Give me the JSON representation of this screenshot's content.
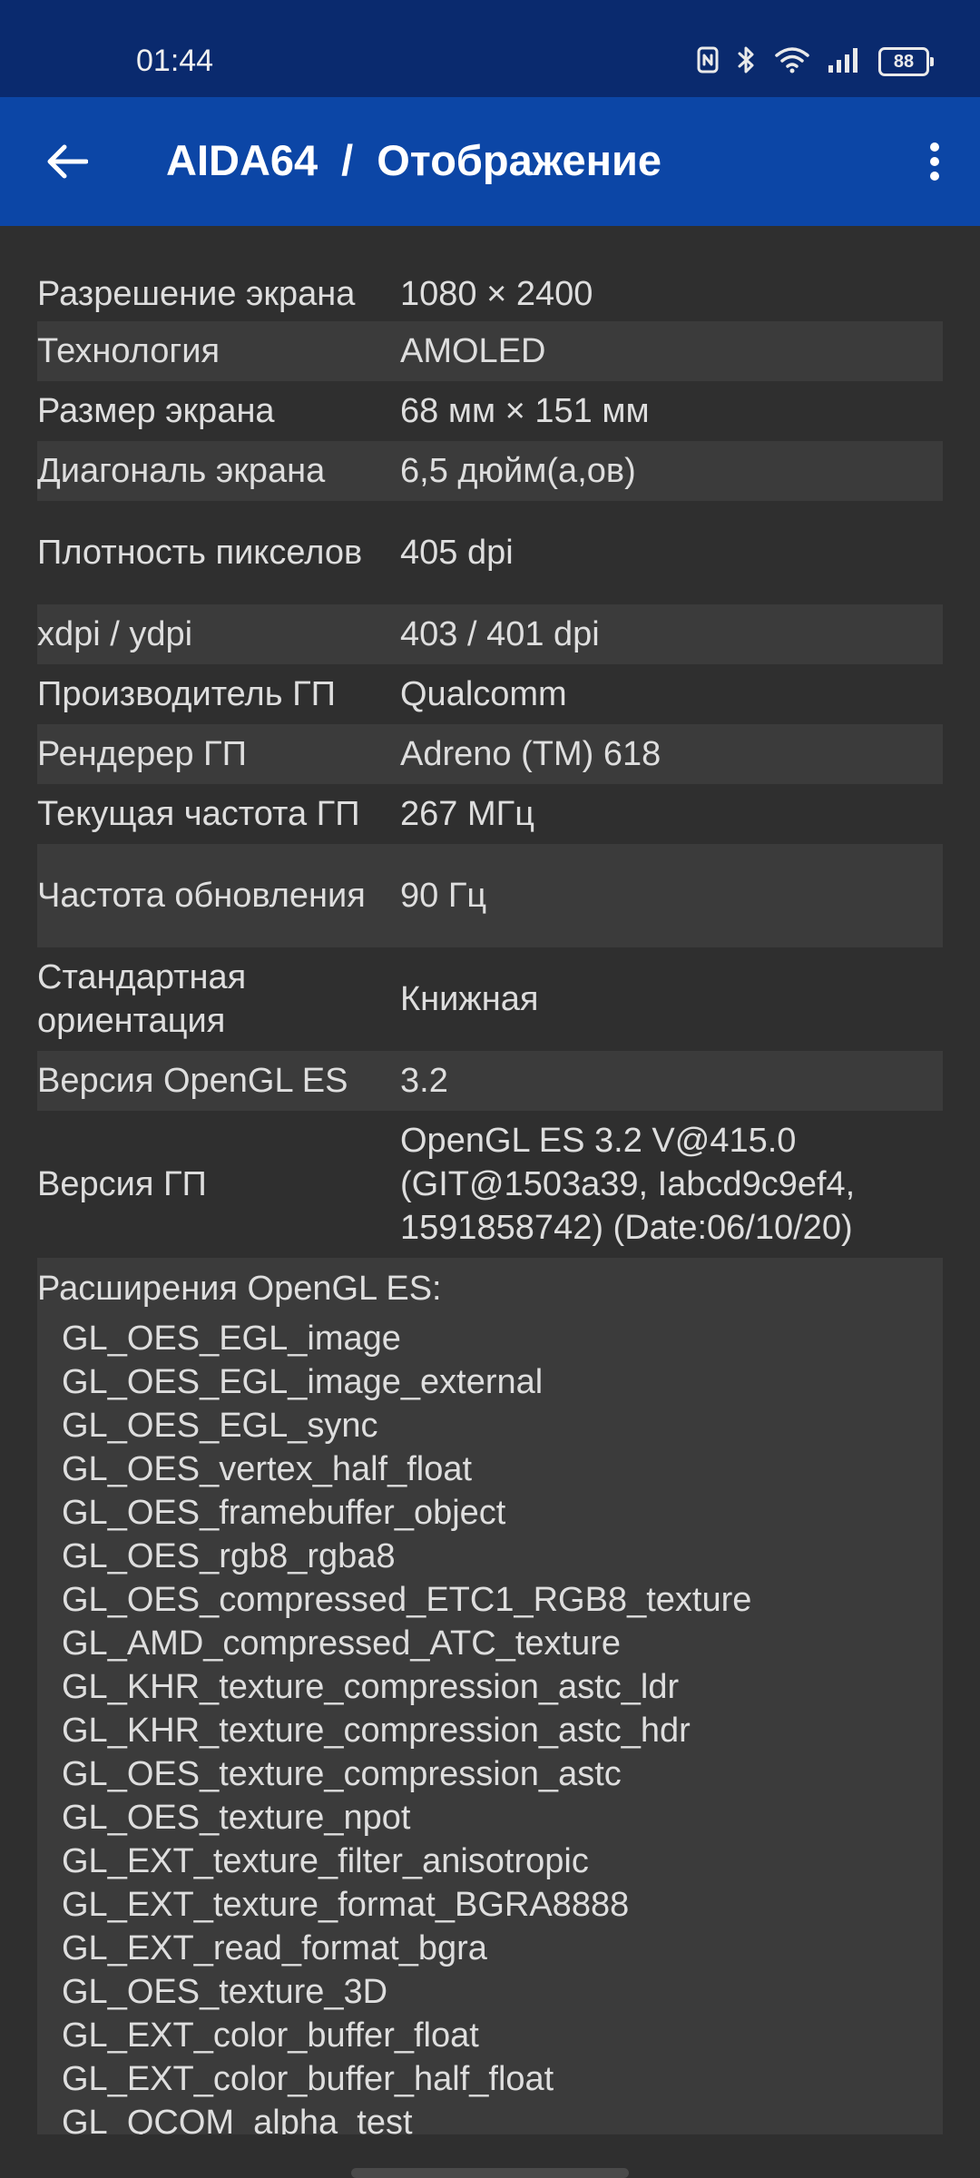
{
  "status_bar": {
    "time": "01:44",
    "battery": "88",
    "icons": [
      "nfc-icon",
      "bluetooth-icon",
      "wifi-icon",
      "signal-icon",
      "battery-icon"
    ]
  },
  "app_bar": {
    "app_name": "AIDA64",
    "separator": "/",
    "section": "Отображение",
    "bg_color": "#0c46a6"
  },
  "rows": [
    {
      "label": "Разрешение экрана",
      "value": "1080 × 2400"
    },
    {
      "label": "Технология",
      "value": "AMOLED"
    },
    {
      "label": "Размер экрана",
      "value": "68 мм × 151 мм"
    },
    {
      "label": "Диагональ экрана",
      "value": "6,5 дюйм(а,ов)"
    },
    {
      "label": "Плотность пикселов",
      "value": "405 dpi"
    },
    {
      "label": "xdpi / ydpi",
      "value": "403 / 401 dpi"
    },
    {
      "label": "Производитель ГП",
      "value": "Qualcomm"
    },
    {
      "label": "Рендерер ГП",
      "value": "Adreno (TM) 618"
    },
    {
      "label": "Текущая частота ГП",
      "value": "267 МГц"
    },
    {
      "label": "Частота обновления",
      "value": "90 Гц"
    },
    {
      "label": "Стандартная ориентация",
      "value": "Книжная"
    },
    {
      "label": "Версия OpenGL ES",
      "value": "3.2"
    },
    {
      "label": "Версия ГП",
      "value": "OpenGL ES 3.2 V@415.0 (GIT@1503a39, Iabcd9c9ef4, 1591858742) (Date:06/10/20)"
    }
  ],
  "extensions": {
    "header": "Расширения OpenGL ES:",
    "items": [
      "GL_OES_EGL_image",
      "GL_OES_EGL_image_external",
      "GL_OES_EGL_sync",
      "GL_OES_vertex_half_float",
      "GL_OES_framebuffer_object",
      "GL_OES_rgb8_rgba8",
      "GL_OES_compressed_ETC1_RGB8_texture",
      "GL_AMD_compressed_ATC_texture",
      "GL_KHR_texture_compression_astc_ldr",
      "GL_KHR_texture_compression_astc_hdr",
      "GL_OES_texture_compression_astc",
      "GL_OES_texture_npot",
      "GL_EXT_texture_filter_anisotropic",
      "GL_EXT_texture_format_BGRA8888",
      "GL_EXT_read_format_bgra",
      "GL_OES_texture_3D",
      "GL_EXT_color_buffer_float",
      "GL_EXT_color_buffer_half_float",
      "GL_QCOM_alpha_test"
    ]
  }
}
